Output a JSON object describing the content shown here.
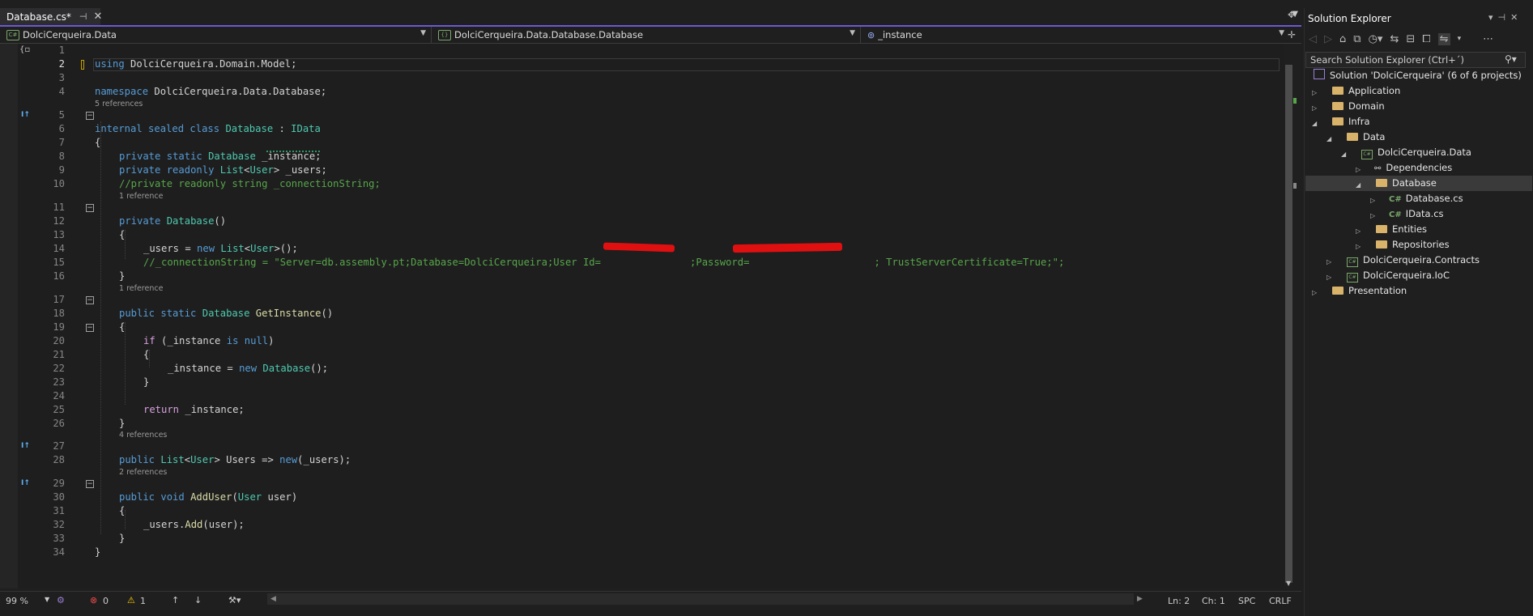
{
  "tab": {
    "title": "Database.cs*",
    "pin": "⊣",
    "close": "✕"
  },
  "navbar": {
    "project": "DolciCerqueira.Data",
    "type": "DolciCerqueira.Data.Database.Database",
    "member": "_instance"
  },
  "codelens": {
    "refs5": "5 references",
    "refs1a": "1 reference",
    "refs1b": "1 reference",
    "refs4": "4 references",
    "refs2": "2 references"
  },
  "lines": {
    "l1": "1",
    "l2": "2",
    "l3": "3",
    "l4": "4",
    "l5": "5",
    "l6": "6",
    "l7": "7",
    "l8": "8",
    "l9": "9",
    "l10": "10",
    "l11": "11",
    "l12": "12",
    "l13": "13",
    "l14": "14",
    "l15": "15",
    "l16": "16",
    "l17": "17",
    "l18": "18",
    "l19": "19",
    "l20": "20",
    "l21": "21",
    "l22": "22",
    "l23": "23",
    "l24": "24",
    "l25": "25",
    "l26": "26",
    "l27": "27",
    "l28": "28",
    "l29": "29",
    "l30": "30",
    "l31": "31",
    "l32": "32",
    "l33": "33",
    "l34": "34"
  },
  "code": {
    "using": "using",
    "using_ns": " DolciCerqueira.Domain.Model;",
    "namespace": "namespace",
    "namespace_name": " DolciCerqueira.Data.Database;",
    "internal": "internal",
    "sealed": "sealed",
    "class": "class",
    "class_name": "Database",
    "colon": " : ",
    "iface": "IData",
    "lbrace": "{",
    "rbrace": "}",
    "private": "private",
    "static": "static",
    "readonly": "readonly",
    "public": "public",
    "void": "void",
    "new": "new",
    "return": "return",
    "if": "if",
    "is": "is",
    "null": "null",
    "Database": "Database",
    "List": "List",
    "User": "User",
    "instance_decl": " _instance;",
    "users_decl": " _users;",
    "conn_comment": "//private readonly string _connectionString;",
    "ctor_parens": "()",
    "users_assign": "_users = ",
    "list_ctor_tail": ">();",
    "conn_line": "//_connectionString = \"Server=db.assembly.pt;Database=DolciCerqueira;User Id=               ;Password=                     ; TrustServerCertificate=True;\";",
    "getinstance": "GetInstance",
    "if_open": " (_instance ",
    "if_close": ")",
    "instance_assign": "_instance = ",
    "new_db_tail": "();",
    "return_tail": " _instance;",
    "users_prop_mid": " Users => ",
    "users_prop_tail": "(_users);",
    "adduser": "AddUser",
    "adduser_param": " user)",
    "users_add": "_users.",
    "add": "Add",
    "add_tail": "(user);",
    "lt": "<",
    "gt": ">"
  },
  "status": {
    "zoom": "99 %",
    "errors": "0",
    "warnings": "1",
    "ln": "Ln: 2",
    "ch": "Ch: 1",
    "spc": "SPC",
    "eol": "CRLF"
  },
  "solution_explorer": {
    "title": "Solution Explorer",
    "search_placeholder": "Search Solution Explorer (Ctrl+´)",
    "items": [
      {
        "label": "Solution 'DolciCerqueira' (6 of 6 projects)"
      },
      {
        "label": "Application"
      },
      {
        "label": "Domain"
      },
      {
        "label": "Infra"
      },
      {
        "label": "Data"
      },
      {
        "label": "DolciCerqueira.Data"
      },
      {
        "label": "Dependencies"
      },
      {
        "label": "Database"
      },
      {
        "label": "Database.cs"
      },
      {
        "label": "IData.cs"
      },
      {
        "label": "Entities"
      },
      {
        "label": "Repositories"
      },
      {
        "label": "DolciCerqueira.Contracts"
      },
      {
        "label": "DolciCerqueira.IoC"
      },
      {
        "label": "Presentation"
      }
    ]
  },
  "colors": {
    "accent": "#6c59d3",
    "keyword": "#569cd6",
    "control": "#d8a0df",
    "type": "#4ec9b0",
    "method": "#dcdcaa",
    "comment": "#57a64a",
    "folder": "#d9b36a"
  }
}
